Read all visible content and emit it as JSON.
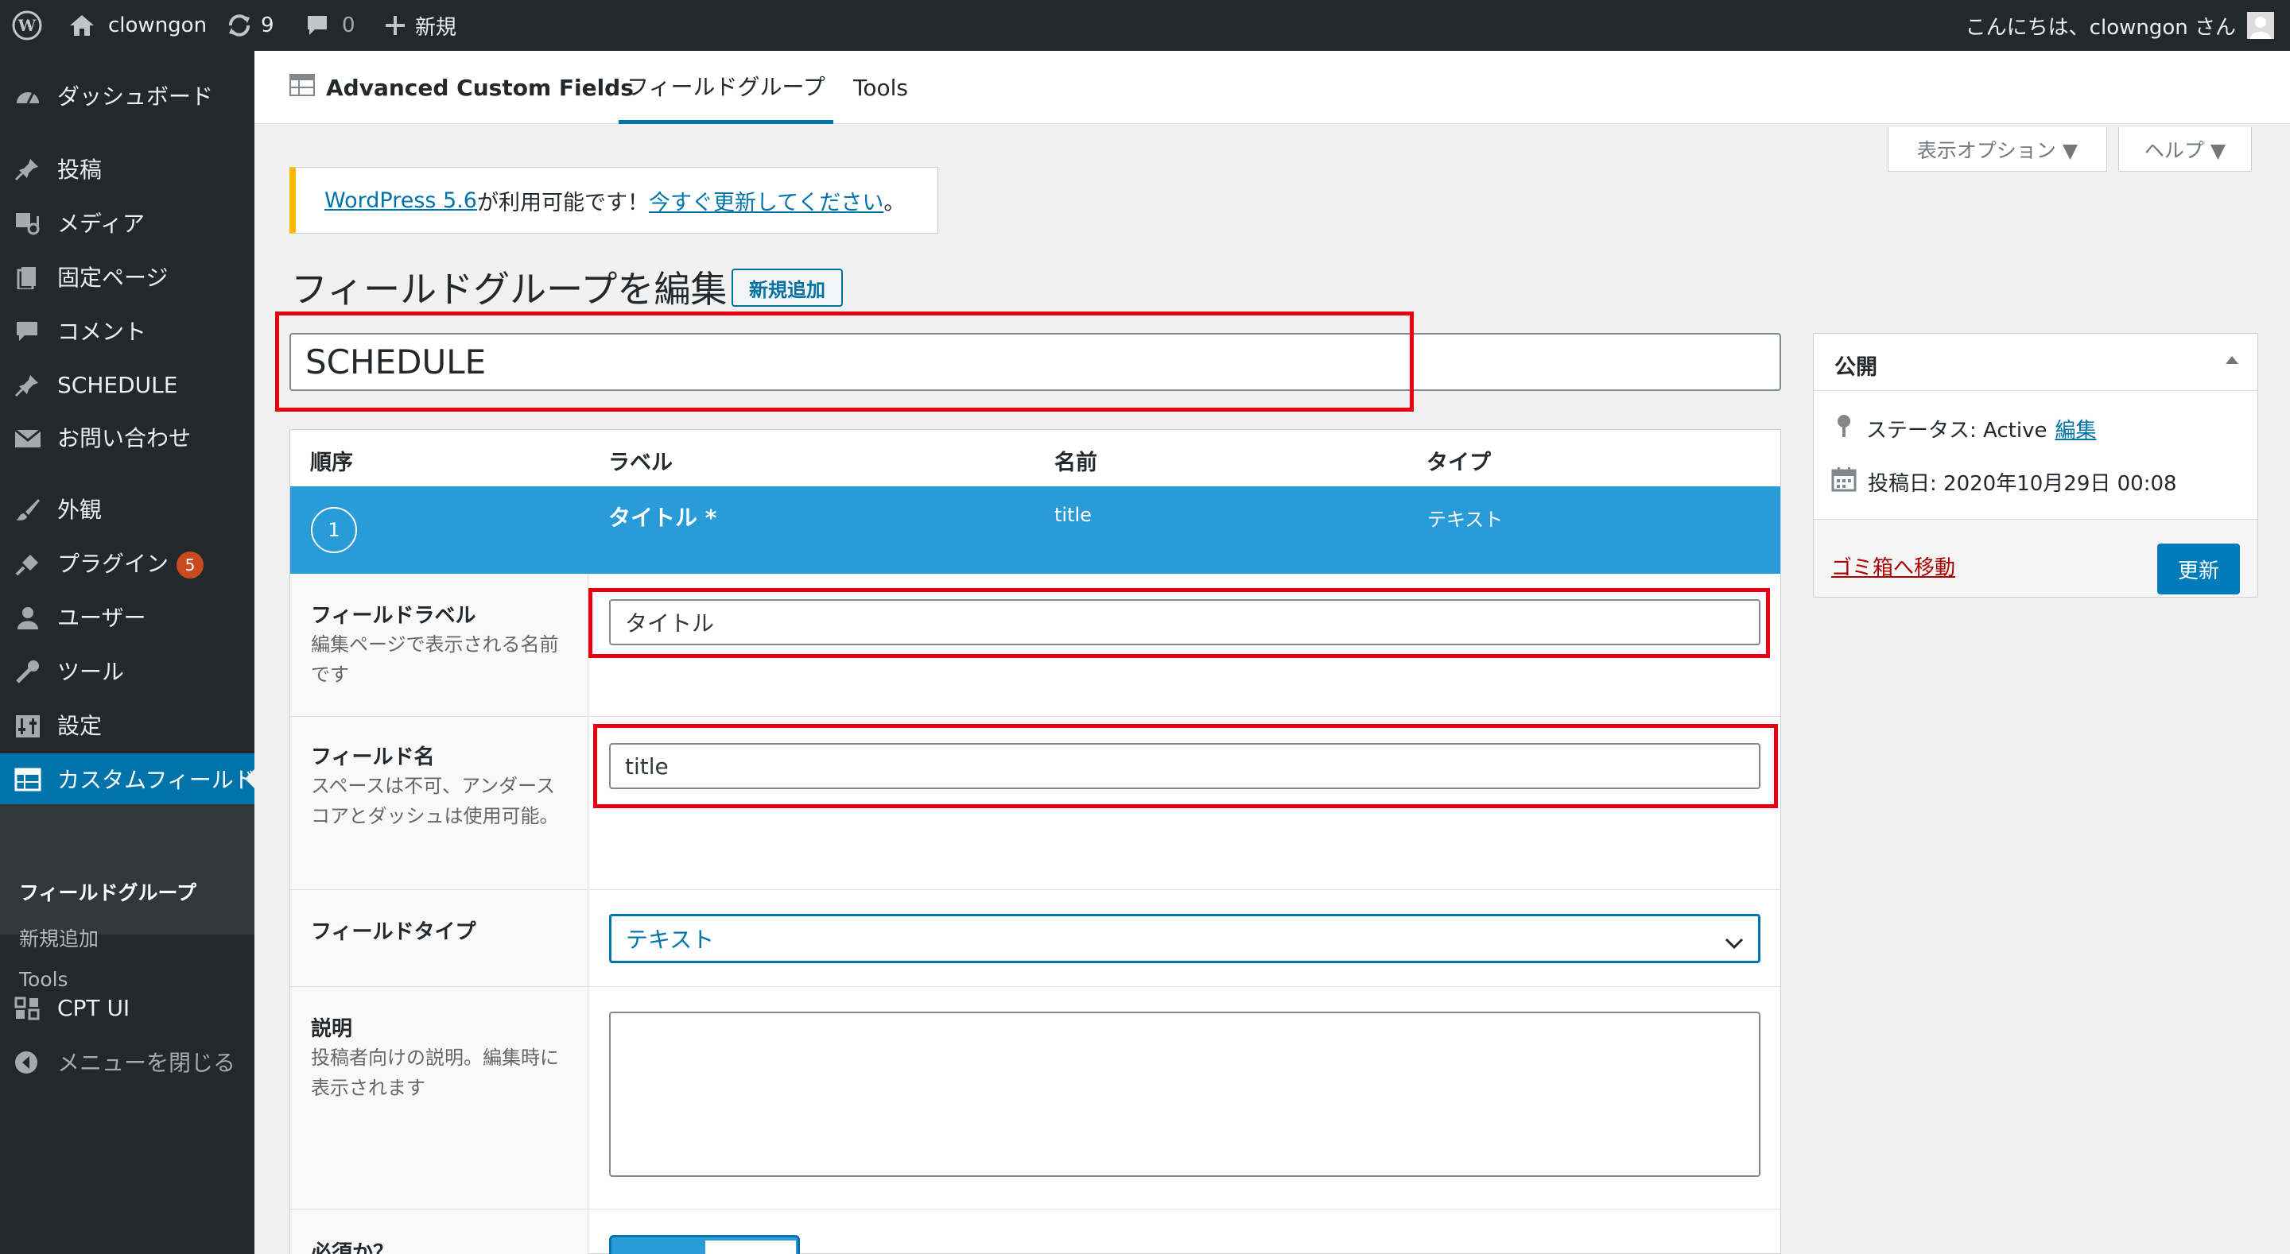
{
  "adminbar": {
    "site_name": "clowngon",
    "updates_count": "9",
    "comments_count": "0",
    "new_label": "新規",
    "greeting": "こんにちは、clowngon さん"
  },
  "sidebar": {
    "items": [
      {
        "label": "ダッシュボード"
      },
      {
        "label": "投稿"
      },
      {
        "label": "メディア"
      },
      {
        "label": "固定ページ"
      },
      {
        "label": "コメント"
      },
      {
        "label": "SCHEDULE"
      },
      {
        "label": "お問い合わせ"
      },
      {
        "label": "外観"
      },
      {
        "label": "プラグイン"
      },
      {
        "label": "ユーザー"
      },
      {
        "label": "ツール"
      },
      {
        "label": "設定"
      },
      {
        "label": "カスタムフィールド"
      },
      {
        "label": "CPT UI"
      },
      {
        "label": "メニューを閉じる"
      }
    ],
    "plugins_badge": "5",
    "submenu": [
      "フィールドグループ",
      "新規追加",
      "Tools"
    ]
  },
  "header": {
    "brand": "Advanced Custom Fields",
    "tabs": [
      "フィールドグループ",
      "Tools"
    ]
  },
  "screen_meta": {
    "options_label": "表示オプション ▼",
    "help_label": "ヘルプ ▼"
  },
  "notice": {
    "link1": "WordPress 5.6",
    "middle": " が利用可能です！",
    "link2": "今すぐ更新してください",
    "end": "。"
  },
  "page": {
    "title": "フィールドグループを編集",
    "add_new": "新規追加",
    "group_title": "SCHEDULE"
  },
  "fields_table": {
    "columns": [
      "順序",
      "ラベル",
      "名前",
      "タイプ"
    ],
    "row": {
      "order": "1",
      "label": "タイトル *",
      "name": "title",
      "type": "テキスト"
    }
  },
  "settings": {
    "field_label": {
      "label": "フィールドラベル",
      "desc": "編集ページで表示される名前です",
      "value": "タイトル"
    },
    "field_name": {
      "label": "フィールド名",
      "desc": "スペースは不可、アンダースコアとダッシュは使用可能。",
      "value": "title"
    },
    "field_type": {
      "label": "フィールドタイプ",
      "value": "テキスト"
    },
    "instructions": {
      "label": "説明",
      "desc": "投稿者向けの説明。編集時に表示されます"
    },
    "required": {
      "label": "必須か？"
    }
  },
  "publish": {
    "title": "公開",
    "status_label": "ステータス: Active",
    "status_edit": "編集",
    "date_label": "投稿日: 2020年10月29日 00:08",
    "trash": "ゴミ箱へ移動",
    "update": "更新"
  },
  "colors": {
    "accent": "#0073aa",
    "row_highlight": "#2a9bd9",
    "highlight_box": "#e60012",
    "sidebar_bg": "#23282d"
  }
}
